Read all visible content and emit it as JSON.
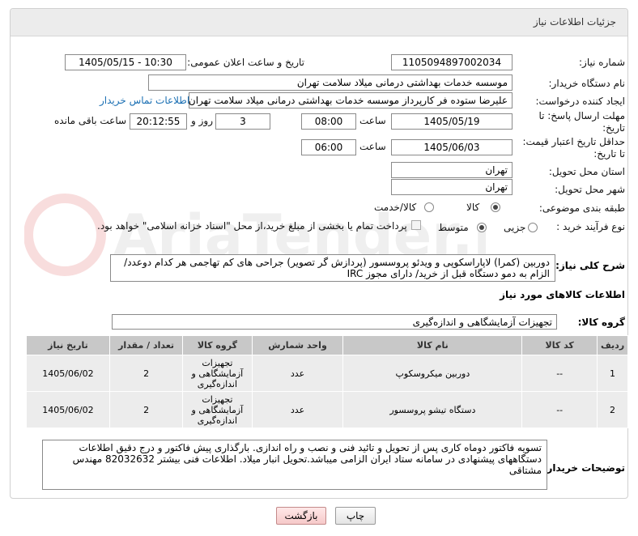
{
  "header": {
    "title": "جزئیات اطلاعات نیاز"
  },
  "fields": {
    "need_number_label": "شماره نیاز:",
    "need_number": "1105094897002034",
    "announce_label": "تاریخ و ساعت اعلان عمومی:",
    "announce_value": "1405/05/15 - 10:30",
    "buyer_label": "نام دستگاه خریدار:",
    "buyer_value": "موسسه خدمات بهداشتی درمانی میلاد سلامت تهران",
    "creator_label": "ایجاد کننده درخواست:",
    "creator_value": "علیرضا ستوده فر کارپرداز موسسه خدمات بهداشتی درمانی میلاد سلامت تهران",
    "contact_link": "اطلاعات تماس خریدار",
    "deadline_label_1": "مهلت ارسال پاسخ: تا",
    "deadline_label_2": "تاریخ:",
    "deadline_date": "1405/05/19",
    "time_label": "ساعت",
    "deadline_time": "08:00",
    "days_value": "3",
    "days_label": "روز و",
    "remaining_time": "20:12:55",
    "remaining_label": "ساعت باقی مانده",
    "validity_label_1": "حداقل تاریخ اعتبار قیمت:",
    "validity_label_2": "تا تاریخ:",
    "validity_date": "1405/06/03",
    "validity_time_label": "ساعت",
    "validity_time": "06:00",
    "province_label": "استان محل تحویل:",
    "province_value": "تهران",
    "city_label": "شهر محل تحویل:",
    "city_value": "تهران",
    "category_label": "طبقه بندی موضوعی:",
    "category_options": [
      "کالا",
      "کالا/خدمت"
    ],
    "process_label": "نوع فرآیند خرید :",
    "process_options": [
      "جزیی",
      "متوسط"
    ],
    "payment_note": "پرداخت تمام یا بخشی از مبلغ خرید،از محل \"اسناد خزانه اسلامی\" خواهد بود."
  },
  "description": {
    "label": "شرح کلی نیاز:",
    "text": "دوربین (کمرا) لاپاراسکوپی و ویدئو پروسسور (پردازش گر تصویر) جراحی های کم تهاجمی هر کدام دوعدد/ الزام به دمو دستگاه قبل از خرید/ دارای مجوز IRC"
  },
  "goods": {
    "section_title": "اطلاعات کالاهای مورد نیاز",
    "group_label": "گروه کالا:",
    "group_value": "تجهیزات آزمایشگاهی و اندازه‌گیری",
    "columns": [
      "ردیف",
      "کد کالا",
      "نام کالا",
      "واحد شمارش",
      "گروه کالا",
      "تعداد / مقدار",
      "تاریخ نیاز"
    ],
    "rows": [
      {
        "row": "1",
        "code": "--",
        "name": "دوربین میکروسکوپ",
        "unit": "عدد",
        "group": "تجهیزات آزمایشگاهی و اندازه‌گیری",
        "qty": "2",
        "date": "1405/06/02"
      },
      {
        "row": "2",
        "code": "--",
        "name": "دستگاه تیشو پروسسور",
        "unit": "عدد",
        "group": "تجهیزات آزمایشگاهی و اندازه‌گیری",
        "qty": "2",
        "date": "1405/06/02"
      }
    ]
  },
  "buyer_notes": {
    "label": "توضیحات خریدار:",
    "text": "تسویه فاکتور دوماه کاری پس از تحویل و تائید فنی و نصب و راه اندازی. بارگذاری پیش فاکتور و درج دقیق اطلاعات دستگاههای پیشنهادی در سامانه ستاد ایران الزامی میباشد.تحویل انبار میلاد. اطلاعات فنی بیشتر 82032632 مهندس مشتاقی"
  },
  "buttons": {
    "print": "چاپ",
    "back": "بازگشت"
  },
  "watermark": "AriaTender.net",
  "colors": {
    "header_bg": "#ececec",
    "table_header_bg": "#c8c8c8",
    "link": "#1a6fb3",
    "back_button": "#f6c9c9"
  }
}
